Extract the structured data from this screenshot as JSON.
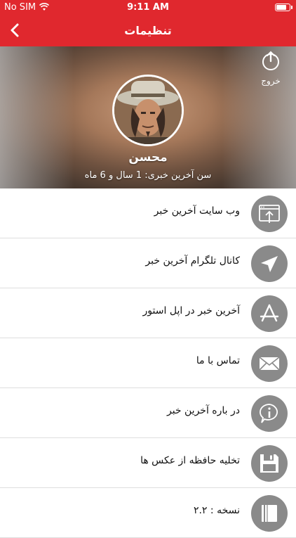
{
  "status": {
    "carrier": "No SIM",
    "time": "9:11 AM"
  },
  "nav": {
    "title": "تنظیمات"
  },
  "profile": {
    "name": "محسن",
    "age_text": "سن آخرین خبری: 1 سال و 6 ماه",
    "logout_label": "خروج"
  },
  "menu": [
    {
      "label": "وب سایت آخرین خبر",
      "icon": "browser-upload-icon"
    },
    {
      "label": "کانال تلگرام آخرین خبر",
      "icon": "send-icon"
    },
    {
      "label": "آخرین خبر در اپل استور",
      "icon": "app-store-icon"
    },
    {
      "label": "تماس با ما",
      "icon": "envelope-icon"
    },
    {
      "label": "در باره آخرین خبر",
      "icon": "info-icon"
    },
    {
      "label": "تخلیه حافظه از عکس ها",
      "icon": "floppy-disk-icon"
    },
    {
      "label": "نسخه : ۲.۲",
      "icon": "book-icon"
    }
  ]
}
